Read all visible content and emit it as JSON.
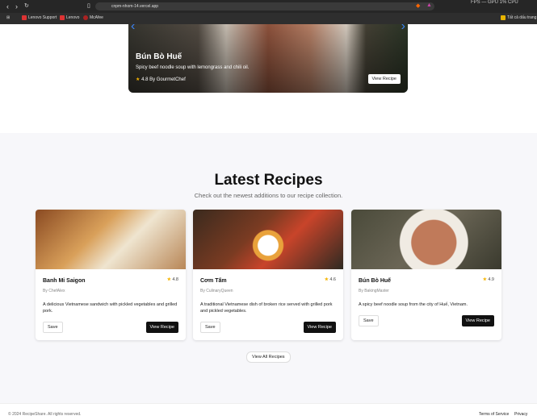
{
  "browser": {
    "url": "cnpm-nhom-14.vercel.app",
    "bookmarks": [
      "Lenovo Support",
      "Lenovo",
      "McAfee"
    ],
    "bookmark_folder": "Tất cả dấu trang",
    "stats": "FPS — GPU 1% CPU"
  },
  "hero": {
    "title": "Bún Bò Huế",
    "description": "Spicy beef noodle soup with lemongrass and chili oil.",
    "rating": "4.8",
    "author": "By GourmetChef",
    "button": "View Recipe"
  },
  "latest": {
    "title": "Latest Recipes",
    "subtitle": "Check out the newest additions to our recipe collection.",
    "view_all": "View All Recipes",
    "cards": [
      {
        "title": "Banh Mi Saigon",
        "rating": "4.8",
        "author": "By ChefAlex",
        "description": "A delicious Vietnamese sandwich with pickled vegetables and grilled pork.",
        "save": "Save",
        "view": "View Recipe"
      },
      {
        "title": "Cơm Tấm",
        "rating": "4.6",
        "author": "By CulinaryQueen",
        "description": "A traditional Vietnamese dish of broken rice served with grilled pork and pickled vegetables.",
        "save": "Save",
        "view": "View Recipe"
      },
      {
        "title": "Bún Bò Huế",
        "rating": "4.9",
        "author": "By BakingMaster",
        "description": "A spicy beef noodle soup from the city of Huế, Vietnam.",
        "save": "Save",
        "view": "View Recipe"
      }
    ]
  },
  "footer": {
    "copyright": "© 2024 RecipeShare. All rights reserved.",
    "terms": "Terms of Service",
    "privacy": "Privacy"
  }
}
